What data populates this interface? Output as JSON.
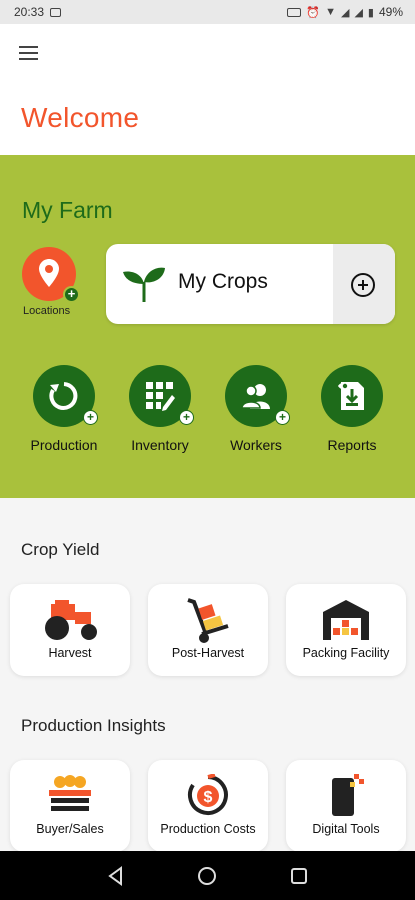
{
  "status": {
    "time": "20:33",
    "battery": "49%"
  },
  "header": {
    "welcome": "Welcome"
  },
  "farm": {
    "title": "My Farm",
    "locations_label": "Locations",
    "crops_label": "My Crops",
    "actions": [
      {
        "label": "Production"
      },
      {
        "label": "Inventory"
      },
      {
        "label": "Workers"
      },
      {
        "label": "Reports"
      }
    ]
  },
  "crop_yield": {
    "title": "Crop Yield",
    "tiles": [
      {
        "label": "Harvest"
      },
      {
        "label": "Post-Harvest"
      },
      {
        "label": "Packing Facility"
      }
    ]
  },
  "insights": {
    "title": "Production Insights",
    "tiles": [
      {
        "label": "Buyer/Sales"
      },
      {
        "label": "Production Costs"
      },
      {
        "label": "Digital Tools"
      }
    ]
  },
  "colors": {
    "accent": "#f2552c",
    "farm_bg": "#a9c13c",
    "dark_green": "#1e6b1a"
  }
}
